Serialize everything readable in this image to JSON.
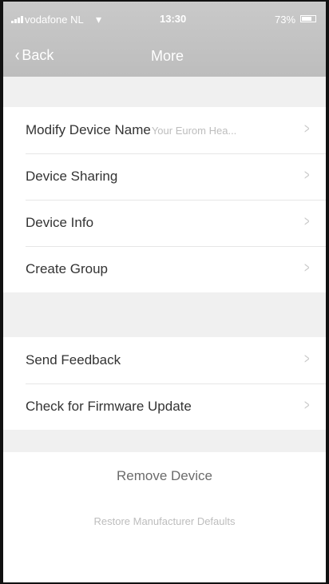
{
  "status_bar": {
    "carrier": "vodafone NL",
    "time": "13:30",
    "battery": "73%"
  },
  "nav": {
    "back_label": "Back",
    "title": "More"
  },
  "settings": {
    "group1": [
      {
        "label": "Modify Device Name",
        "value": "Your Eurom Hea..."
      },
      {
        "label": "Device Sharing"
      },
      {
        "label": "Device Info"
      },
      {
        "label": "Create Group"
      }
    ],
    "group2": [
      {
        "label": "Send Feedback"
      },
      {
        "label": "Check for Firmware Update"
      }
    ]
  },
  "actions": {
    "remove_device": "Remove Device",
    "restore_defaults": "Restore Manufacturer Defaults"
  },
  "icons": {
    "chevron": "chevron-right-icon",
    "back": "chevron-left-icon"
  },
  "colors": {
    "nav_bg": "#c4c4c4",
    "spacer_bg": "#f0f0f0",
    "label_text": "#333333",
    "muted_text": "#bdbdbd"
  }
}
